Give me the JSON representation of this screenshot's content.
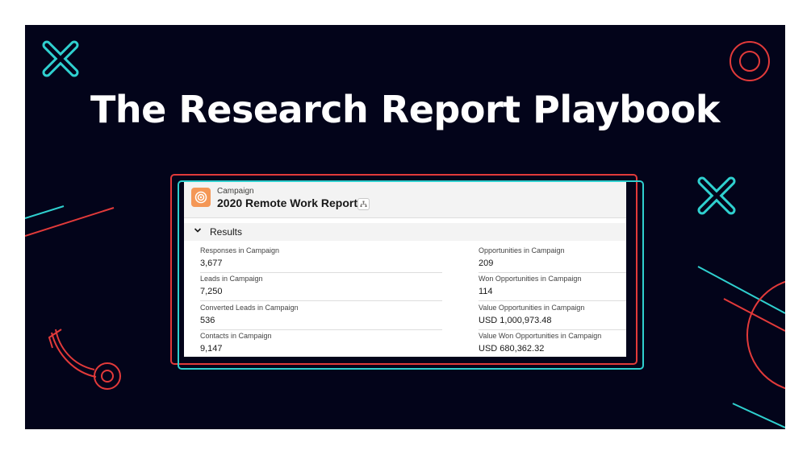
{
  "headline": "The Research Report Playbook",
  "colors": {
    "background": "#03041a",
    "red": "#e23a3a",
    "teal": "#2fd0cf",
    "record_icon": "#f49756"
  },
  "record": {
    "object_label": "Campaign",
    "title": "2020 Remote Work Report",
    "icon": "target-icon"
  },
  "section": {
    "title": "Results"
  },
  "fields_left": [
    {
      "label": "Responses in Campaign",
      "value": "3,677"
    },
    {
      "label": "Leads in Campaign",
      "value": "7,250"
    },
    {
      "label": "Converted Leads in Campaign",
      "value": "536"
    },
    {
      "label": "Contacts in Campaign",
      "value": "9,147"
    }
  ],
  "fields_right": [
    {
      "label": "Opportunities in Campaign",
      "value": "209"
    },
    {
      "label": "Won Opportunities in Campaign",
      "value": "114"
    },
    {
      "label": "Value Opportunities in Campaign",
      "value": "USD 1,000,973.48"
    },
    {
      "label": "Value Won Opportunities in Campaign",
      "value": "USD 680,362.32"
    }
  ]
}
